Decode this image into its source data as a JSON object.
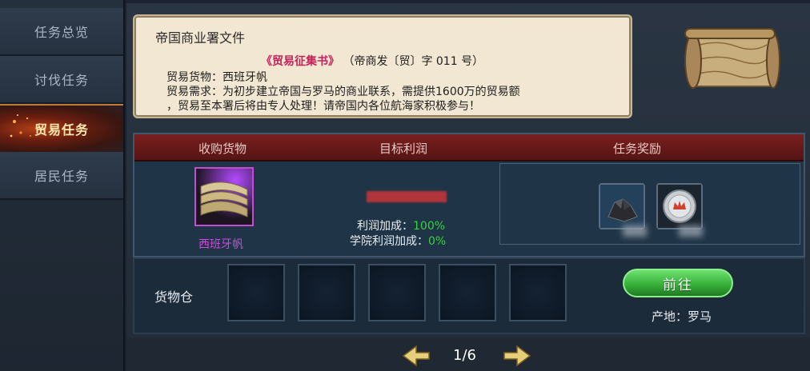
{
  "sidebar": {
    "tabs": [
      {
        "label": "任务总览"
      },
      {
        "label": "讨伐任务"
      },
      {
        "label": "贸易任务",
        "active": true
      },
      {
        "label": "居民任务"
      }
    ]
  },
  "letter": {
    "title": "帝国商业署文件",
    "book": "《贸易征集书》",
    "doc_no": "（帝商发〔贸〕字 011 号）",
    "goods_line": "贸易货物：西班牙帆",
    "demand_line": "贸易需求：为初步建立帝国与罗马的商业联系，需提供1600万的贸易额",
    "demand_line2": "，贸易至本署后将由专人处理！请帝国内各位航海家积极参与！"
  },
  "table": {
    "headers": [
      "收购货物",
      "目标利润",
      "任务奖励"
    ],
    "goods_name": "西班牙帆",
    "profit_label": "利润加成：",
    "profit_value": "100%",
    "academy_label": "学院利润加成：",
    "academy_value": "0%"
  },
  "warehouse": {
    "label": "货物仓",
    "slots": 5,
    "go_button": "前往",
    "origin": "产地：罗马"
  },
  "pager": {
    "current": "1/6"
  },
  "colors": {
    "header_red": "#7a1f1f",
    "goods_purple": "#d546e0",
    "bonus_green": "#35d43f",
    "button_green": "#38b23a"
  }
}
